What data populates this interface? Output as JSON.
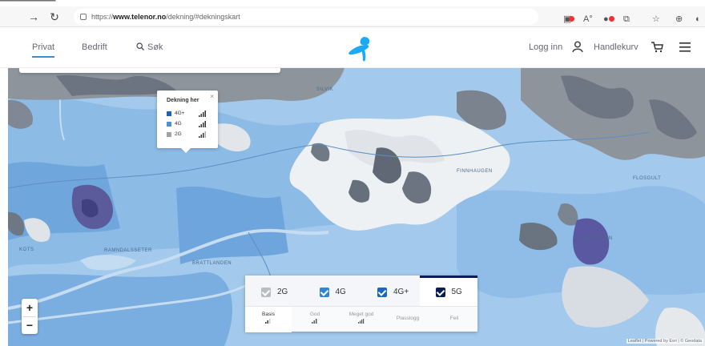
{
  "browser": {
    "url_prefix": "https://",
    "url_domain": "www.telenor.no",
    "url_path": "/dekning/#dekningskart"
  },
  "header": {
    "nav": [
      "Privat",
      "Bedrift"
    ],
    "search_label": "Søk",
    "login_label": "Logg inn",
    "cart_label": "Handlekurv",
    "brand_color": "#19aaf8"
  },
  "legend": {
    "title": "Dekning her",
    "items": [
      {
        "label": "4G+",
        "color": "#1e63b8"
      },
      {
        "label": "4G",
        "color": "#4f8fd4"
      },
      {
        "label": "2G",
        "color": "#9fa3a8"
      }
    ]
  },
  "zoom": {
    "in_label": "+",
    "out_label": "−"
  },
  "technologies": [
    {
      "label": "2G",
      "checked": true,
      "color": "#b9bdc2"
    },
    {
      "label": "4G",
      "checked": true,
      "color": "#2e86d8"
    },
    {
      "label": "4G+",
      "checked": true,
      "color": "#1a66c4"
    },
    {
      "label": "5G",
      "checked": true,
      "color": "#0a1d5a"
    }
  ],
  "quality_levels": [
    "Basis",
    "God",
    "Meget god",
    "Plasslogg",
    "Feil"
  ],
  "attribution": "Leaflet | Powered by Esri | © Geodata",
  "map_labels": [
    "SILVIK",
    "KOTS",
    "BRATTLANDEN",
    "RAMNDALSSETER",
    "FINNHAUGEN",
    "HAVLDALEN",
    "FLOSGULT"
  ]
}
